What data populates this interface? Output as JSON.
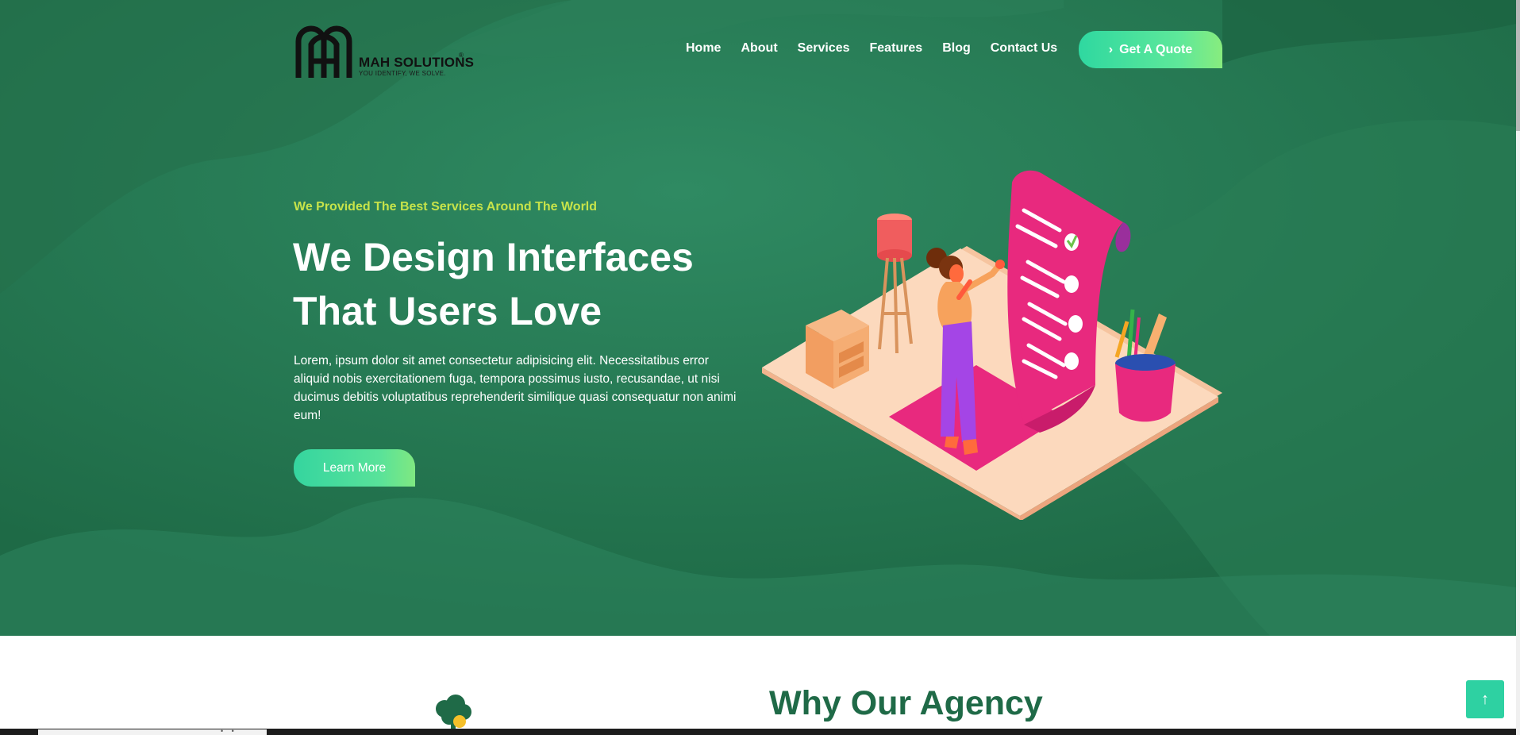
{
  "brand": {
    "name": "MAH SOLUTIONS",
    "tagline": "YOU IDENTIFY, WE SOLVE.",
    "registered": "®"
  },
  "nav": {
    "items": [
      {
        "label": "Home"
      },
      {
        "label": "About"
      },
      {
        "label": "Services"
      },
      {
        "label": "Features"
      },
      {
        "label": "Blog"
      },
      {
        "label": "Contact Us"
      }
    ],
    "cta_label": "Get A Quote",
    "cta_icon": "chevron-right-icon"
  },
  "hero": {
    "eyebrow": "We Provided The Best Services Around The World",
    "headline_line1": "We Design Interfaces",
    "headline_line2": "That Users Love",
    "description": "Lorem, ipsum dolor sit amet consectetur adipisicing elit. Necessitatibus error aliquid nobis exercitationem fuga, tempora possimus iusto, recusandae, ut nisi ducimus debitis voluptatibus reprehenderit similique quasi consequatur non animi eum!",
    "button_label": "Learn More"
  },
  "section": {
    "title": "Why Our Agency"
  },
  "back_to_top": {
    "icon": "arrow-up-icon",
    "symbol": "↑"
  },
  "colors": {
    "hero_bg": "#25774f",
    "accent": "#2fd8a0",
    "eyebrow": "#c6e34a",
    "section_title": "#1f6a47",
    "pink": "#e8297e"
  }
}
